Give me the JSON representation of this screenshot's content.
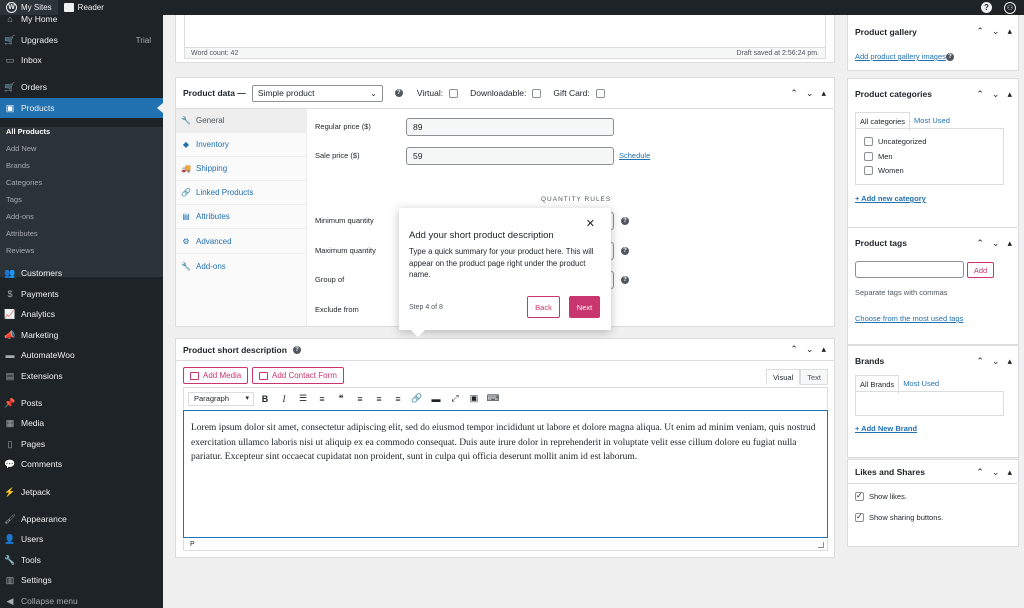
{
  "topbar": {
    "my_sites": "My Sites",
    "reader": "Reader",
    "help_glyph": "?",
    "icons": [
      "wordpress-logo-icon",
      "reader-icon",
      "help-icon",
      "user-avatar-icon"
    ]
  },
  "sidebar": {
    "items": [
      {
        "label": "My Home",
        "icon": "home-icon",
        "glyph": "⌂"
      },
      {
        "label": "Upgrades",
        "badge": "Trial",
        "icon": "cart-icon",
        "glyph": "🛒"
      },
      {
        "label": "Inbox",
        "icon": "inbox-icon",
        "glyph": "▭"
      },
      {
        "label": "Orders",
        "icon": "orders-icon",
        "glyph": "🛒"
      },
      {
        "label": "Products",
        "icon": "products-icon",
        "glyph": "▣"
      },
      {
        "label": "Customers",
        "icon": "customers-icon",
        "glyph": "👥"
      },
      {
        "label": "Payments",
        "icon": "payments-icon",
        "glyph": "$"
      },
      {
        "label": "Analytics",
        "icon": "analytics-icon",
        "glyph": "📈"
      },
      {
        "label": "Marketing",
        "icon": "marketing-icon",
        "glyph": "📣"
      },
      {
        "label": "AutomateWoo",
        "icon": "automatewoo-icon",
        "glyph": "▬"
      },
      {
        "label": "Extensions",
        "icon": "extensions-icon",
        "glyph": "▤"
      },
      {
        "label": "Posts",
        "icon": "posts-icon",
        "glyph": "📌"
      },
      {
        "label": "Media",
        "icon": "media-icon",
        "glyph": "▦"
      },
      {
        "label": "Pages",
        "icon": "pages-icon",
        "glyph": "▯"
      },
      {
        "label": "Comments",
        "icon": "comments-icon",
        "glyph": "💬"
      },
      {
        "label": "Jetpack",
        "icon": "jetpack-icon",
        "glyph": "⚡"
      },
      {
        "label": "Appearance",
        "icon": "appearance-icon",
        "glyph": "🖌"
      },
      {
        "label": "Users",
        "icon": "users-icon",
        "glyph": "👤"
      },
      {
        "label": "Tools",
        "icon": "tools-icon",
        "glyph": "🔧"
      },
      {
        "label": "Settings",
        "icon": "settings-icon",
        "glyph": "▥"
      },
      {
        "label": "Collapse menu",
        "icon": "collapse-icon",
        "glyph": "◀"
      }
    ],
    "submenu": [
      "All Products",
      "Add New",
      "Brands",
      "Categories",
      "Tags",
      "Add-ons",
      "Attributes",
      "Reviews"
    ]
  },
  "editor_top": {
    "word_count": "Word count: 42",
    "draft_saved": "Draft saved at 2:56:24 pm."
  },
  "product_data": {
    "title": "Product data —",
    "type_select": "Simple product",
    "virtual_label": "Virtual:",
    "downloadable_label": "Downloadable:",
    "gift_card_label": "Gift Card:",
    "tabs": [
      {
        "label": "General",
        "icon": "wrench-icon",
        "glyph": "🔧"
      },
      {
        "label": "Inventory",
        "icon": "inventory-icon",
        "glyph": "◆"
      },
      {
        "label": "Shipping",
        "icon": "shipping-icon",
        "glyph": "🚚"
      },
      {
        "label": "Linked Products",
        "icon": "link-icon",
        "glyph": "🔗"
      },
      {
        "label": "Attributes",
        "icon": "attributes-icon",
        "glyph": "▤"
      },
      {
        "label": "Advanced",
        "icon": "gear-icon",
        "glyph": "⚙"
      },
      {
        "label": "Add-ons",
        "icon": "addons-icon",
        "glyph": "🔧"
      }
    ],
    "regular_price_label": "Regular price ($)",
    "regular_price_value": "89",
    "sale_price_label": "Sale price ($)",
    "sale_price_value": "59",
    "schedule_link": "Schedule",
    "quantity_rules_title": "QUANTITY RULES",
    "min_qty_label": "Minimum quantity",
    "max_qty_label": "Maximum quantity",
    "group_of_label": "Group of",
    "exclude_from_label": "Exclude from"
  },
  "short_description": {
    "title": "Product short description",
    "add_media": "Add Media",
    "add_contact_form": "Add Contact Form",
    "tab_visual": "Visual",
    "tab_text": "Text",
    "format_select": "Paragraph",
    "content": "Lorem ipsum dolor sit amet, consectetur adipiscing elit, sed do eiusmod tempor incididunt ut labore et dolore magna aliqua. Ut enim ad minim veniam, quis nostrud exercitation ullamco laboris nisi ut aliquip ex ea commodo consequat. Duis aute irure dolor in reprehenderit in voluptate velit esse cillum dolore eu fugiat nulla pariatur. Excepteur sint occaecat cupidatat non proident, sunt in culpa qui officia deserunt mollit anim id est laborum.",
    "path": "P",
    "toolbar_icons": [
      {
        "name": "bold-icon",
        "glyph": "B"
      },
      {
        "name": "italic-icon",
        "glyph": "I"
      },
      {
        "name": "bullet-list-icon",
        "glyph": "☰"
      },
      {
        "name": "numbered-list-icon",
        "glyph": "≡"
      },
      {
        "name": "blockquote-icon",
        "glyph": "❝"
      },
      {
        "name": "align-left-icon",
        "glyph": "≡"
      },
      {
        "name": "align-center-icon",
        "glyph": "≡"
      },
      {
        "name": "align-right-icon",
        "glyph": "≡"
      },
      {
        "name": "insert-link-icon",
        "glyph": "🔗"
      },
      {
        "name": "read-more-icon",
        "glyph": "▬"
      },
      {
        "name": "fullscreen-icon",
        "glyph": "⤢"
      },
      {
        "name": "toolbar-toggle-icon",
        "glyph": "▣"
      },
      {
        "name": "keyboard-icon",
        "glyph": "⌨"
      }
    ]
  },
  "tour": {
    "title": "Add your short product description",
    "body": "Type a quick summary for your product here. This will appear on the product page right under the product name.",
    "step": "Step 4 of 8",
    "back": "Back",
    "next": "Next",
    "close_glyph": "✕"
  },
  "right": {
    "gallery": {
      "title": "Product gallery",
      "link": "Add product gallery images"
    },
    "categories": {
      "title": "Product categories",
      "tab_all": "All categories",
      "tab_most": "Most Used",
      "items": [
        "Uncategorized",
        "Men",
        "Women"
      ],
      "add_link": "+ Add new category"
    },
    "tags": {
      "title": "Product tags",
      "add_btn": "Add",
      "hint": "Separate tags with commas",
      "choose_link": "Choose from the most used tags"
    },
    "brands": {
      "title": "Brands",
      "tab_all": "All Brands",
      "tab_most": "Most Used",
      "add_link": "+ Add New Brand"
    },
    "likes": {
      "title": "Likes and Shares",
      "show_likes": "Show likes.",
      "show_sharing": "Show sharing buttons."
    }
  },
  "colors": {
    "accent": "#2271b1",
    "brand_pink": "#c9356e",
    "sidebar_bg": "#1d2327"
  }
}
